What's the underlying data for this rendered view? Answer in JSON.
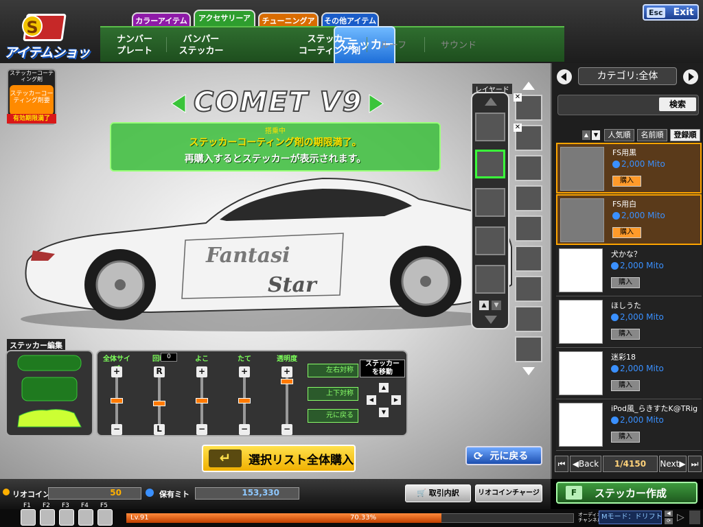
{
  "header": {
    "logo_text": "アイテムショップ",
    "category_tabs": [
      "カラーアイテム",
      "アクセサリーアイテム",
      "チューニングアイテム",
      "その他アイテム"
    ],
    "sub_tabs": [
      "ナンバー\nプレート",
      "バンパー\nステッカー",
      "ステッカー",
      "ステッカー\nコーティング剤",
      "ルーフ",
      "サウンド"
    ],
    "exit_key": "Esc",
    "exit_label": "Exit"
  },
  "coating_badge": {
    "title": "ステッカーコーティング剤",
    "icon_text": "ステッカーコーティング剤要",
    "expired_label": "有効期限満了"
  },
  "car": {
    "name": "COMET V9"
  },
  "notice": {
    "tag": "搭乗中",
    "line1": "ステッカーコーティング剤の期限満了。",
    "line2": "再購入するとステッカーが表示されます。"
  },
  "layers": {
    "label": "レイヤード"
  },
  "sticker_edit": {
    "title": "ステッカー編集",
    "sliders": [
      {
        "label": "全体サイズ",
        "top_btn": "+",
        "bottom_btn": "−",
        "value": 0.55
      },
      {
        "label": "回転",
        "top_btn": "R",
        "bottom_btn": "L",
        "value": 0.5,
        "readout": "0"
      },
      {
        "label": "よこ",
        "top_btn": "+",
        "bottom_btn": "−",
        "value": 0.55
      },
      {
        "label": "たて",
        "top_btn": "+",
        "bottom_btn": "−",
        "value": 0.55
      },
      {
        "label": "透明度",
        "top_btn": "+",
        "bottom_btn": "−",
        "value": 0.92
      }
    ],
    "mirror_buttons": [
      "左右対称",
      "上下対称",
      "元に戻る"
    ],
    "move_label": "ステッカー\nを移動"
  },
  "actions": {
    "buy_all": "選択リスト全体購入",
    "reset": "元に戻る"
  },
  "right_panel": {
    "category_label": "カテゴリ:全体",
    "search_button": "検索",
    "sort_buttons": [
      "人気順",
      "名前順",
      "登録順"
    ],
    "items": [
      {
        "name": "FS用黒",
        "price": "2,000 Mito",
        "buy": "購入",
        "highlight": true
      },
      {
        "name": "FS用白",
        "price": "2,000 Mito",
        "buy": "購入",
        "highlight": true
      },
      {
        "name": "犬かな？",
        "price": "2,000 Mito",
        "buy": "購入",
        "highlight": false
      },
      {
        "name": "ほしうた",
        "price": "2,000 Mito",
        "buy": "購入",
        "highlight": false
      },
      {
        "name": "迷彩18",
        "price": "2,000 Mito",
        "buy": "購入",
        "highlight": false
      },
      {
        "name": "iPod風_らきすたK@TRig",
        "price": "2,000 Mito",
        "buy": "購入",
        "highlight": false
      }
    ],
    "pager": {
      "back": "Back",
      "page": "1",
      "total": "4150",
      "next": "Next"
    },
    "create_key": "F",
    "create_label": "ステッカー作成"
  },
  "footer": {
    "rio_label": "リオコイン",
    "rio_value": "50",
    "mito_label": "保有ミト",
    "mito_value": "153,330",
    "history_button": "取引内訳",
    "charge_button": "リオコインチャージ",
    "fkeys": [
      "F1",
      "F2",
      "F3",
      "F4",
      "F5"
    ],
    "level": "Lv.91",
    "exp_percent": "70.33%",
    "exp_fraction": 0.7033,
    "audio_label": "オーディオ\nチャンネル",
    "mode_text": "Mモード：ドリフト"
  }
}
